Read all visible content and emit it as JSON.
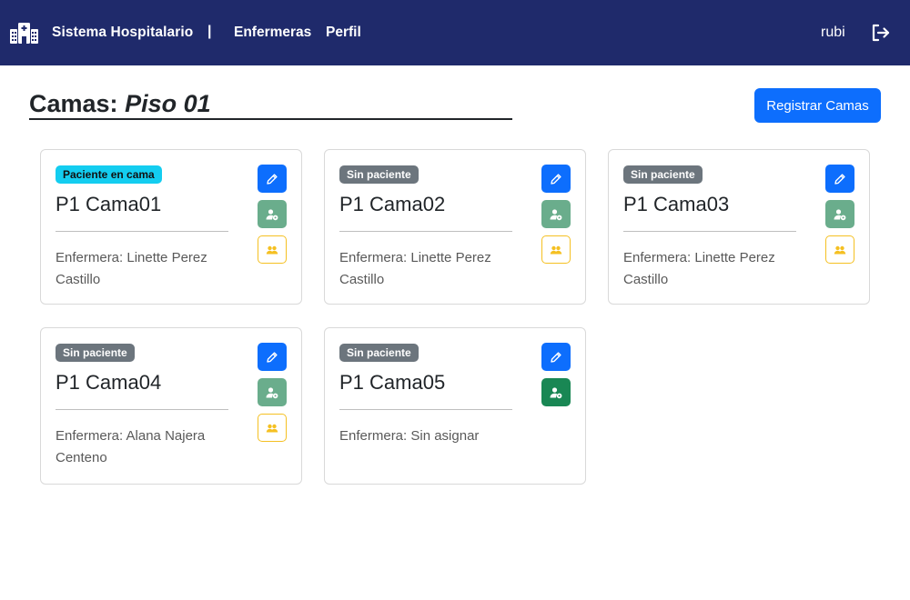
{
  "navbar": {
    "brand": "Sistema Hospitalario",
    "separator": "|",
    "links": [
      "Enfermeras",
      "Perfil"
    ],
    "user": "rubi",
    "brand_icon": "hospital-icon",
    "logout_icon": "logout-icon",
    "color": "#1f2a6b"
  },
  "header": {
    "title_prefix": "Camas:",
    "floor": "Piso 01",
    "register_button": "Registrar Camas"
  },
  "beds": [
    {
      "status": "Paciente en cama",
      "occupied": true,
      "name": "P1 Cama01",
      "nurse": "Enfermera: Linette Perez Castillo",
      "has_nurse": true
    },
    {
      "status": "Sin paciente",
      "occupied": false,
      "name": "P1 Cama02",
      "nurse": "Enfermera: Linette Perez Castillo",
      "has_nurse": true
    },
    {
      "status": "Sin paciente",
      "occupied": false,
      "name": "P1 Cama03",
      "nurse": "Enfermera: Linette Perez Castillo",
      "has_nurse": true
    },
    {
      "status": "Sin paciente",
      "occupied": false,
      "name": "P1 Cama04",
      "nurse": "Enfermera: Alana Najera Centeno",
      "has_nurse": true
    },
    {
      "status": "Sin paciente",
      "occupied": false,
      "name": "P1 Cama05",
      "nurse": "Enfermera: Sin asignar",
      "has_nurse": false
    }
  ],
  "colors": {
    "primary": "#0d6efd",
    "occupied_badge": "#13cdf0",
    "empty_badge": "#6c757d",
    "assign_disabled": "#6aad8c",
    "assign_enabled": "#198754",
    "warning": "#f5c022"
  }
}
